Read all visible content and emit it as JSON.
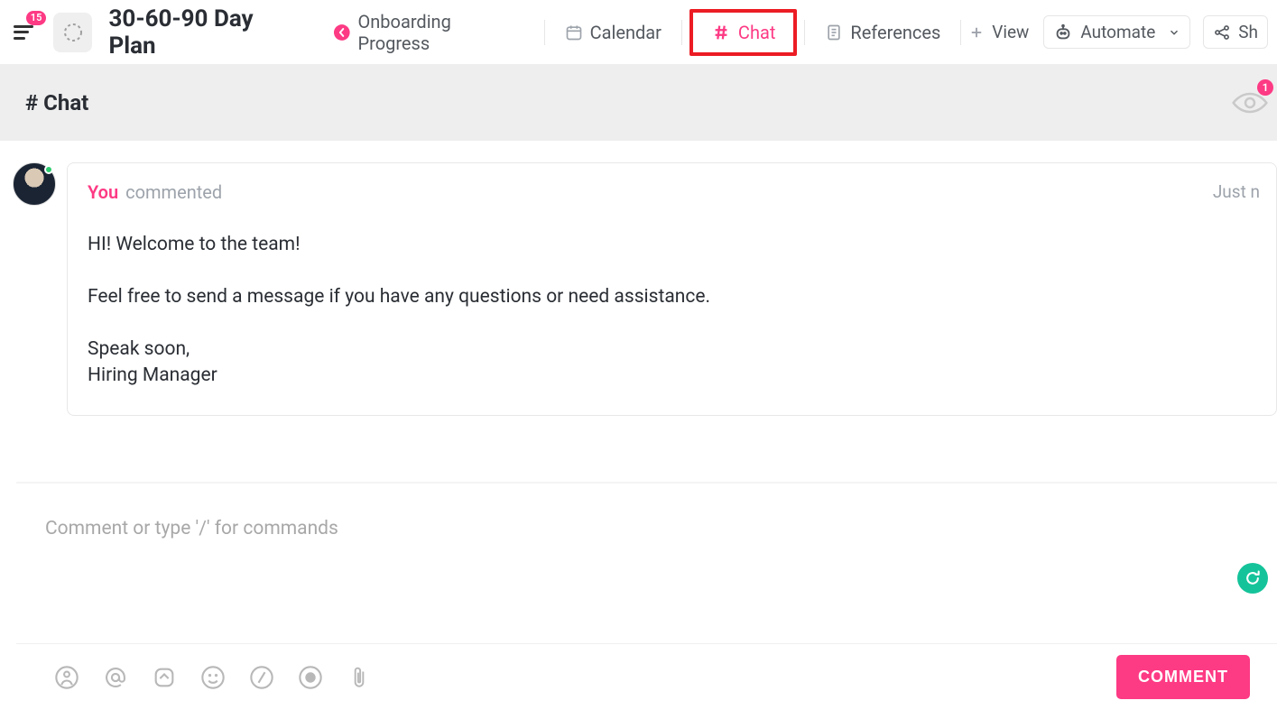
{
  "toolbar": {
    "menu_badge": "15",
    "page_title": "30-60-90 Day Plan",
    "tabs": {
      "onboarding": {
        "label": "Onboarding Progress"
      },
      "calendar": {
        "label": "Calendar"
      },
      "chat": {
        "label": "Chat"
      },
      "references": {
        "label": "References"
      }
    },
    "view_label": "View",
    "automate_label": "Automate",
    "share_label": "Sh"
  },
  "subheader": {
    "title": "# Chat",
    "watch_count": "1"
  },
  "message": {
    "author": "You",
    "action": "commented",
    "time": "Just n",
    "line1": "HI! Welcome to the team!",
    "line2": "Feel free to send a message if you have any questions or need assistance.",
    "line3a": "Speak soon,",
    "line3b": "Hiring Manager"
  },
  "composer": {
    "placeholder": "Comment or type '/' for commands",
    "submit_label": "COMMENT"
  }
}
